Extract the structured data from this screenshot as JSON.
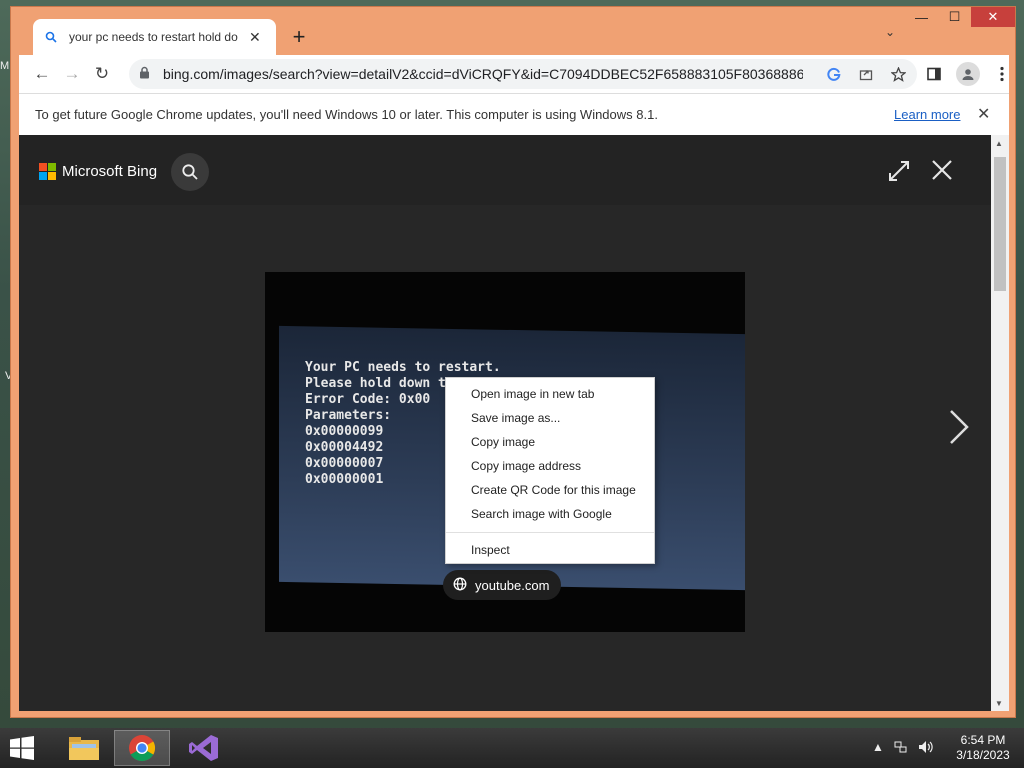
{
  "desktop": {
    "edge_text_top": "M",
    "edge_text_mid": "V"
  },
  "window": {
    "minimize": "—",
    "maximize": "☐",
    "close": "✕"
  },
  "tab": {
    "title": "your pc needs to restart hold do",
    "close": "✕",
    "new_tab": "+",
    "tab_search": "⌄"
  },
  "toolbar": {
    "back": "←",
    "forward": "→",
    "reload": "↻",
    "url": "bing.com/images/search?view=detailV2&ccid=dViCRQFY&id=C7094DDBEC52F658883105F80368886...",
    "icons": [
      "google-lens-icon",
      "share-icon",
      "bookmark-star-icon",
      "side-panel-icon",
      "profile-icon",
      "menu-icon"
    ]
  },
  "infobar": {
    "text": "To get future Google Chrome updates, you'll need Windows 10 or later. This computer is using Windows 8.1.",
    "link": "Learn more",
    "close": "✕"
  },
  "bing": {
    "logo_text": "Microsoft Bing",
    "logo_colors": [
      "#f25022",
      "#7fba00",
      "#00a4ef",
      "#ffb900"
    ]
  },
  "image": {
    "error_text": "Your PC needs to restart.\nPlease hold down the power button\nError Code: 0x00\nParameters:\n0x00000099\n0x00004492\n0x00000007\n0x00000001",
    "source": "youtube.com"
  },
  "context_menu": {
    "items": [
      "Open image in new tab",
      "Save image as...",
      "Copy image",
      "Copy image address",
      "Create QR Code for this image",
      "Search image with Google"
    ],
    "inspect": "Inspect"
  },
  "taskbar": {
    "clock_time": "6:54 PM",
    "clock_date": "3/18/2023"
  }
}
